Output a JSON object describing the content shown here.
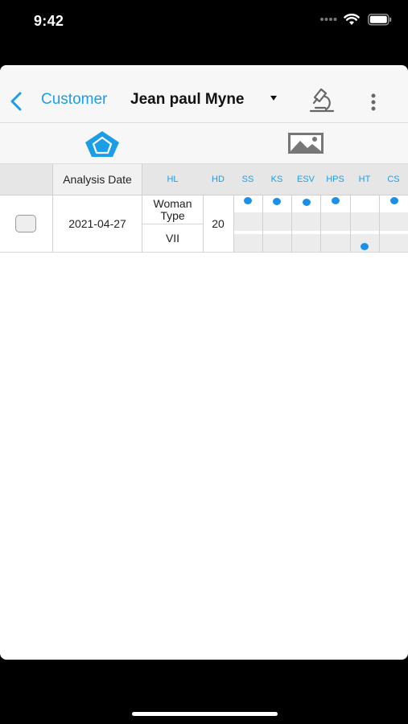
{
  "status_bar": {
    "time": "9:42"
  },
  "nav": {
    "back_label": "Customer",
    "title": "Jean paul Myne"
  },
  "table": {
    "headers": {
      "analysis_date": "Analysis Date",
      "hl": "HL",
      "hd": "HD",
      "ss": "SS",
      "ks": "KS",
      "esv": "ESV",
      "hps": "HPS",
      "ht": "HT",
      "cs": "CS"
    },
    "rows": [
      {
        "checked": false,
        "analysis_date": "2021-04-27",
        "hl_top_line1": "Woman",
        "hl_top_line2": "Type",
        "hl_bottom": "VII",
        "hd": "20",
        "top_marks": [
          "SS",
          "KS",
          "ESV",
          "HPS",
          "CS"
        ],
        "bottom_marks": [
          "HT"
        ]
      }
    ]
  },
  "colors": {
    "accent": "#1c9ee6",
    "dot": "#1c8fe8"
  },
  "icons": {
    "back": "chevron-left-icon",
    "dropdown": "caret-down-icon",
    "microscope": "microscope-icon",
    "more": "more-vertical-icon",
    "chart_view": "pentagon-icon",
    "image_view": "image-icon"
  }
}
